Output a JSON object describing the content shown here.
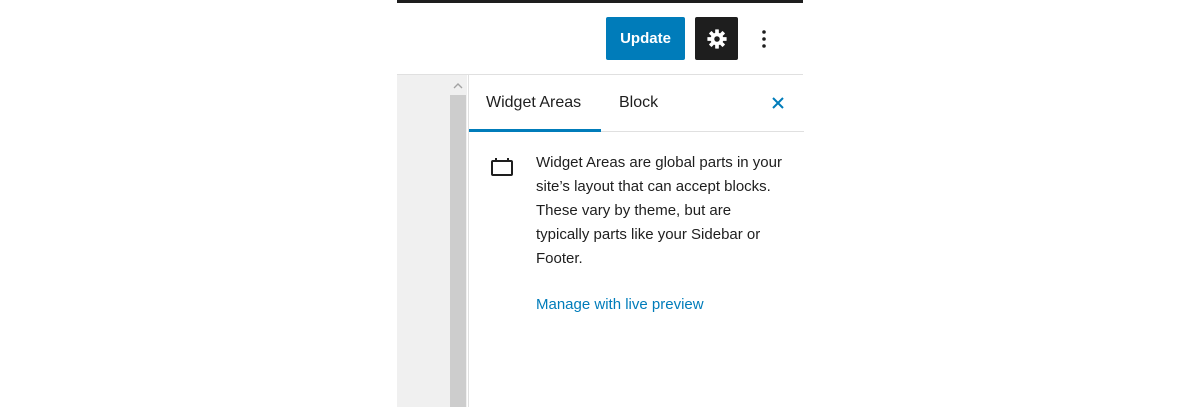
{
  "header": {
    "update_label": "Update",
    "settings_icon": "gear-icon",
    "more_icon": "vertical-ellipsis-icon"
  },
  "sidebar": {
    "tabs": [
      {
        "label": "Widget Areas",
        "active": true
      },
      {
        "label": "Block",
        "active": false
      }
    ],
    "close_icon": "close-icon",
    "panel": {
      "icon": "widget-area-icon",
      "description": "Widget Areas are global parts in your site’s layout that can accept blocks. These vary by theme, but are typically parts like your Sidebar or Footer.",
      "link_label": "Manage with live preview"
    }
  },
  "colors": {
    "accent": "#007cba",
    "dark": "#1e1e1e",
    "canvas": "#f0f0f0",
    "border": "#e0e0e0"
  }
}
